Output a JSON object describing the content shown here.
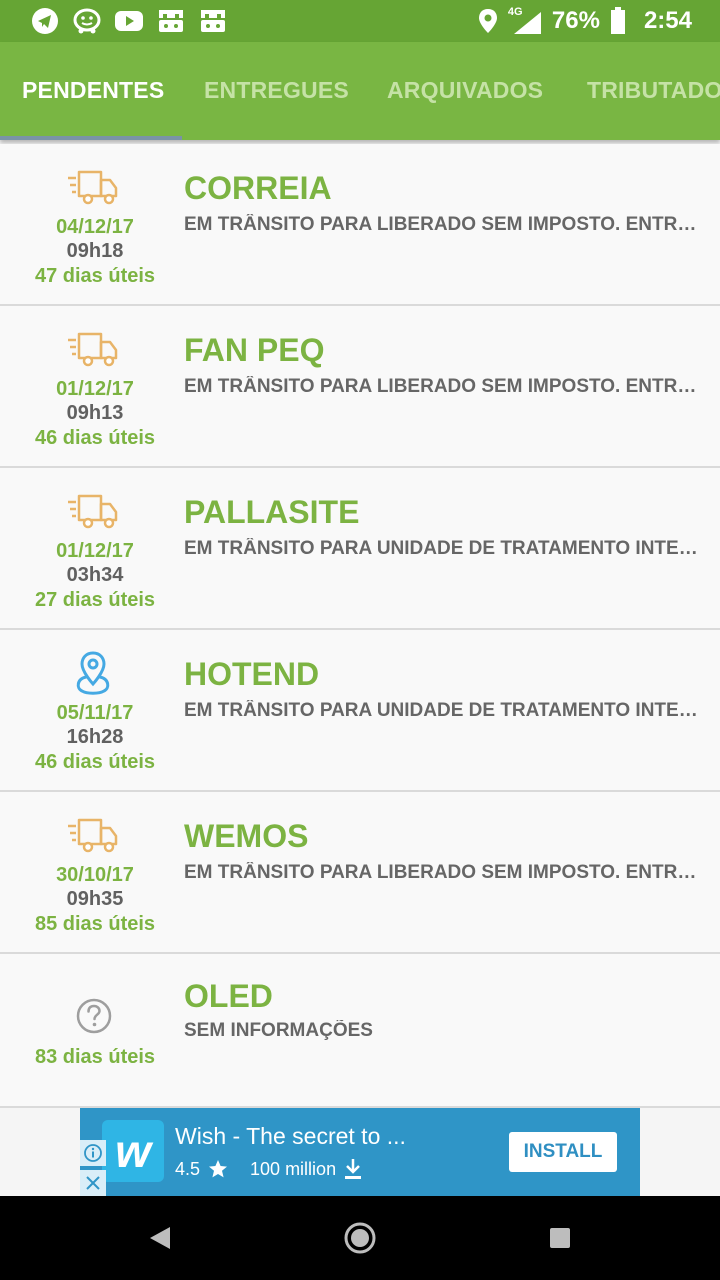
{
  "status_bar": {
    "network": "4G",
    "battery": "76%",
    "time": "2:54",
    "icons": [
      "telegram-icon",
      "waze-icon",
      "youtube-icon",
      "game-icon",
      "game-icon"
    ]
  },
  "tabs": [
    {
      "label": "PENDENTES",
      "active": true
    },
    {
      "label": "ENTREGUES",
      "active": false
    },
    {
      "label": "ARQUIVADOS",
      "active": false
    },
    {
      "label": "TRIBUTADOS",
      "active": false
    }
  ],
  "colors": {
    "primary": "#79b643",
    "status_bar": "#66a534",
    "accent_text": "#7cb342",
    "truck_icon": "#e8b468",
    "location_icon": "#45a9e3",
    "ad_background": "#2f95c7"
  },
  "packages": [
    {
      "name": "CORREIA",
      "status": "EM TRÂNSITO PARA LIBERADO SEM IMPOSTO. ENTREGA PREVISTA",
      "date": "04/12/17",
      "time": "09h18",
      "days": "47 dias úteis",
      "icon": "truck-icon"
    },
    {
      "name": "FAN PEQ",
      "status": "EM TRÂNSITO PARA LIBERADO SEM IMPOSTO. ENTREGA PREVISTA",
      "date": "01/12/17",
      "time": "09h13",
      "days": "46 dias úteis",
      "icon": "truck-icon"
    },
    {
      "name": "PALLASITE",
      "status": "EM TRÂNSITO PARA UNIDADE DE TRATAMENTO INTERNACIONAL",
      "date": "01/12/17",
      "time": "03h34",
      "days": "27 dias úteis",
      "icon": "truck-icon"
    },
    {
      "name": "HOTEND",
      "status": "EM TRÂNSITO PARA UNIDADE DE TRATAMENTO INTERNACIONAL",
      "date": "05/11/17",
      "time": "16h28",
      "days": "46 dias úteis",
      "icon": "location-pin-icon"
    },
    {
      "name": "WEMOS",
      "status": "EM TRÂNSITO PARA LIBERADO SEM IMPOSTO. ENTREGA PREVISTA",
      "date": "30/10/17",
      "time": "09h35",
      "days": "85 dias úteis",
      "icon": "truck-icon"
    },
    {
      "name": "OLED",
      "status": "SEM INFORMAÇÕES",
      "days": "83 dias úteis",
      "icon": "question-icon"
    }
  ],
  "ad": {
    "title": "Wish - The secret to ...",
    "rating": "4.5",
    "downloads": "100 million",
    "install_label": "INSTALL",
    "logo_letter": "w"
  }
}
